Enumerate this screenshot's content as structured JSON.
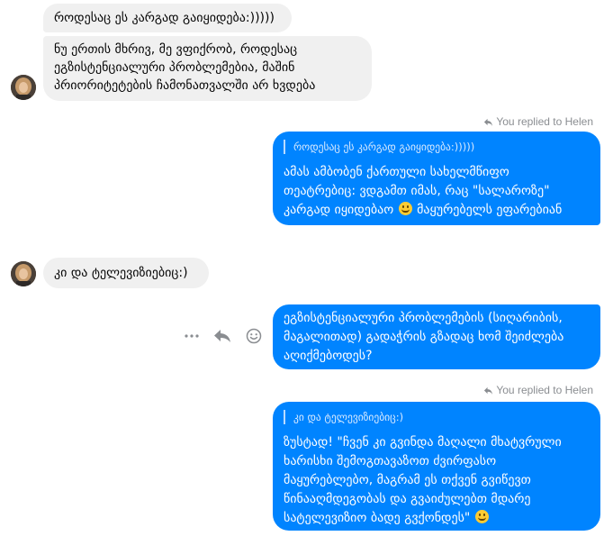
{
  "colors": {
    "outgoing": "#0084ff",
    "incoming": "#f0f0f0",
    "meta": "#8a8d91"
  },
  "messages": {
    "in1": {
      "text": "როდესაც ეს კარგად გაიყიდება:)))))"
    },
    "in2": {
      "lines": [
        "ნუ ერთის მხრივ, მე ვფიქრობ, როდესაც",
        "ეგზისტენციალური პრობლემებია, მაშინ",
        "პრიორიტეტების ჩამონათვალში არ ხვდება"
      ]
    },
    "reply1": {
      "replied_label": "You replied to Helen",
      "quote": "როდესაც ეს კარგად გაიყიდება:)))))",
      "lines": [
        "ამას ამბობენ ქართული სახელმწიფო",
        "თეატრებიც: ვდგამთ იმას, რაც \"სალაროზე\"",
        "კარგად იყიდებაო"
      ],
      "line3_tail": "მაყურებელს ეფარებიან"
    },
    "in3": {
      "text": "კი და ტელევიზიებიც:)"
    },
    "out2": {
      "lines": [
        "ეგზისტენციალური პრობლემების (სიღარიბის,",
        "მაგალითად) გადაჭრის გზადაც ხომ შეიძლება",
        "აღიქმებოდეს?"
      ]
    },
    "reply2": {
      "replied_label": "You replied to Helen",
      "quote": "კი და ტელევიზიებიც:)",
      "lines": [
        "ზუსტად! \"ჩვენ კი გვინდა მაღალი მხატვრული",
        "ხარისხი შემოგთავაზოთ ძვირფასო",
        "მაყურებლებო, მაგრამ ეს თქვენ გვიწევთ",
        "წინააღმდეგობას და გვაიძულებთ მდარე",
        "სატელევიზიო ბადე გვქონდეს\""
      ]
    }
  },
  "icons": {
    "more": "more-dots-icon",
    "reply": "reply-arrow-icon",
    "react": "smiley-react-icon",
    "emoji": "grinning-emoji"
  }
}
